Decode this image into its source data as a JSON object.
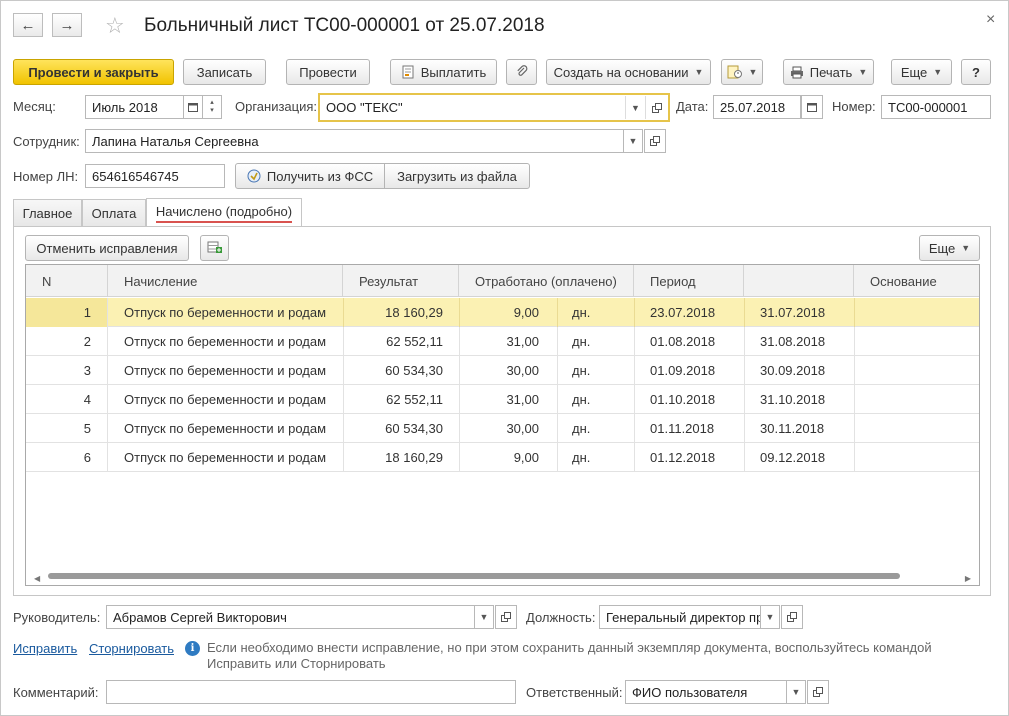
{
  "window": {
    "title": "Больничный лист ТС00-000001 от 25.07.2018",
    "back_glyph": "←",
    "forward_glyph": "→",
    "star_glyph": "☆",
    "close_glyph": "×"
  },
  "toolbar": {
    "post_close": "Провести и закрыть",
    "save": "Записать",
    "post": "Провести",
    "pay": "Выплатить",
    "create_based": "Создать на основании",
    "print": "Печать",
    "more": "Еще",
    "help": "?"
  },
  "form": {
    "month_label": "Месяц:",
    "month_value": "Июль 2018",
    "org_label": "Организация:",
    "org_value": "ООО \"ТЕКС\"",
    "date_label": "Дата:",
    "date_value": "25.07.2018",
    "number_label": "Номер:",
    "number_value": "ТС00-000001",
    "employee_label": "Сотрудник:",
    "employee_value": "Лапина Наталья Сергеевна",
    "ln_label": "Номер ЛН:",
    "ln_value": "654616546745",
    "get_fss": "Получить из ФСС",
    "load_file": "Загрузить из файла"
  },
  "tabs": [
    {
      "label": "Главное"
    },
    {
      "label": "Оплата"
    },
    {
      "label": "Начислено (подробно)"
    }
  ],
  "grid_toolbar": {
    "cancel_fixes": "Отменить исправления",
    "more": "Еще"
  },
  "table": {
    "headers": [
      "N",
      "Начисление",
      "Результат",
      "Отработано (оплачено)",
      "Период",
      "",
      "Основание"
    ],
    "rows": [
      {
        "n": "1",
        "accrual": "Отпуск по беременности и родам",
        "result": "18 160,29",
        "worked": "9,00",
        "unit": "дн.",
        "from": "23.07.2018",
        "to": "31.07.2018",
        "basis": ""
      },
      {
        "n": "2",
        "accrual": "Отпуск по беременности и родам",
        "result": "62 552,11",
        "worked": "31,00",
        "unit": "дн.",
        "from": "01.08.2018",
        "to": "31.08.2018",
        "basis": ""
      },
      {
        "n": "3",
        "accrual": "Отпуск по беременности и родам",
        "result": "60 534,30",
        "worked": "30,00",
        "unit": "дн.",
        "from": "01.09.2018",
        "to": "30.09.2018",
        "basis": ""
      },
      {
        "n": "4",
        "accrual": "Отпуск по беременности и родам",
        "result": "62 552,11",
        "worked": "31,00",
        "unit": "дн.",
        "from": "01.10.2018",
        "to": "31.10.2018",
        "basis": ""
      },
      {
        "n": "5",
        "accrual": "Отпуск по беременности и родам",
        "result": "60 534,30",
        "worked": "30,00",
        "unit": "дн.",
        "from": "01.11.2018",
        "to": "30.11.2018",
        "basis": ""
      },
      {
        "n": "6",
        "accrual": "Отпуск по беременности и родам",
        "result": "18 160,29",
        "worked": "9,00",
        "unit": "дн.",
        "from": "01.12.2018",
        "to": "09.12.2018",
        "basis": ""
      }
    ]
  },
  "footer": {
    "head_label": "Руководитель:",
    "head_value": "Абрамов Сергей Викторович",
    "position_label": "Должность:",
    "position_value": "Генеральный директор пр",
    "fix_link": "Исправить",
    "reverse_link": "Сторнировать",
    "info_text": "Если необходимо внести исправление, но при этом сохранить данный экземпляр документа, воспользуйтесь командой Исправить или Сторнировать",
    "comment_label": "Комментарий:",
    "comment_value": "",
    "responsible_label": "Ответственный:",
    "responsible_value": "ФИО пользователя"
  },
  "colors": {
    "primary_button": "#f1c300",
    "selected_row": "#fbf1b3",
    "link": "#1a5a9e",
    "tab_underline": "#d9534f"
  }
}
